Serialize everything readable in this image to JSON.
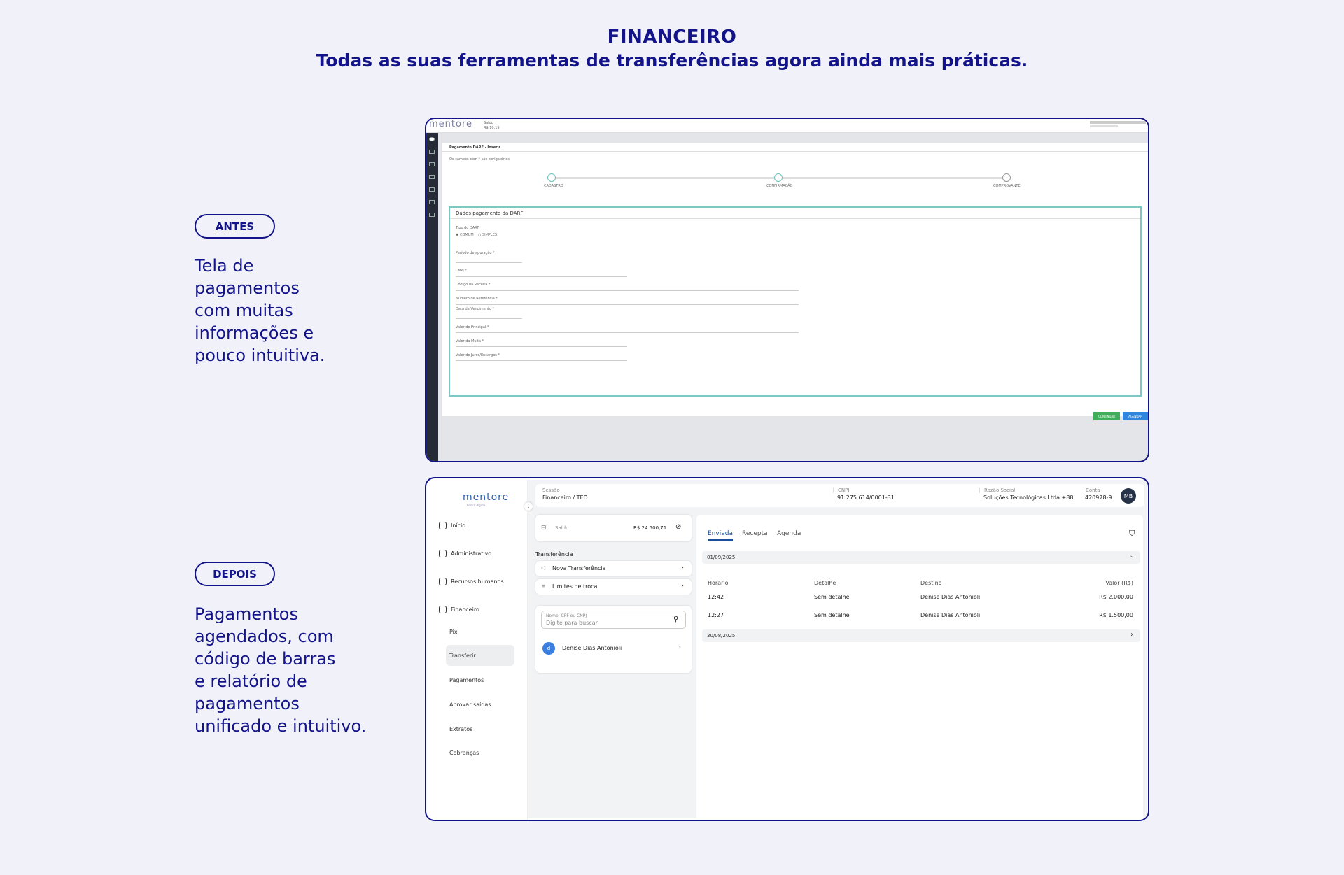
{
  "hero": {
    "title": "FINANCEIRO",
    "subtitle": "Todas as suas ferramentas de transferências agora ainda mais práticas."
  },
  "before": {
    "label": "ANTES",
    "lines": [
      "Tela de",
      "pagamentos",
      "com muitas",
      "informações e",
      "pouco intuitiva."
    ],
    "screen": {
      "logo": "mentore",
      "saldo_label": "Saldo",
      "saldo_value": "R$ 10,19",
      "window_title": "Pagamento DARF - Inserir",
      "required_note": "Os campos com * são obrigatórios",
      "steps": [
        "CADASTRO",
        "CONFIRMAÇÃO",
        "COMPROVANTE"
      ],
      "card_title": "Dados pagamento da DARF",
      "darf_type_label": "Tipo do DARF",
      "darf_options": [
        "COMUM",
        "SIMPLES"
      ],
      "fields": [
        "Período de apuração *",
        "CNPJ *",
        "Código da Receita *",
        "Número de Referência *",
        "Data de Vencimento *",
        "Valor do Principal *",
        "Valor da Multa *",
        "Valor do Juros/Encargos *"
      ],
      "btn_continue": "CONTINUAR",
      "btn_schedule": "AGENDAR",
      "colors": {
        "continue": "#3fae5a",
        "schedule": "#2f86dc"
      }
    }
  },
  "after": {
    "label": "DEPOIS",
    "lines": [
      "Pagamentos",
      "agendados, com",
      "código de barras",
      "e relatório de",
      "pagamentos",
      "unificado e intuitivo."
    ],
    "screen": {
      "logo": "mentore",
      "logo_sub": "banco digital",
      "nav": [
        "Início",
        "Administrativo",
        "Recursos humanos",
        "Financeiro"
      ],
      "subnav": [
        "Pix",
        "Transferir",
        "Pagamentos",
        "Aprovar saídas",
        "Extratos",
        "Cobranças"
      ],
      "header": {
        "session_label": "Sessão",
        "session_value": "Financeiro / TED",
        "cnpj_label": "CNPJ",
        "cnpj_value": "91.275.614/0001-31",
        "razao_label": "Razão Social",
        "razao_value": "Soluções Tecnológicas Ltda +88",
        "conta_label": "Conta",
        "conta_value": "420978-9",
        "avatar": "MB"
      },
      "saldo_label": "Saldo",
      "saldo_value": "R$ 24.500,71",
      "transfer_heading": "Transferência",
      "actions": [
        "Nova Transferência",
        "Limites de troca"
      ],
      "search_label": "Nome, CPF ou CNPJ",
      "search_placeholder": "Digite para buscar",
      "contact": "Denise Dias Antonioli",
      "contact_initial": "d",
      "tabs": [
        "Enviada",
        "Recepta",
        "Agenda"
      ],
      "group1_date": "01/09/2025",
      "group2_date": "30/08/2025",
      "columns": [
        "Horário",
        "Detalhe",
        "Destino",
        "Valor (R$)"
      ],
      "rows": [
        {
          "time": "12:42",
          "detail": "Sem detalhe",
          "dest": "Denise Dias Antonioli",
          "value": "R$ 2.000,00"
        },
        {
          "time": "12:27",
          "detail": "Sem detalhe",
          "dest": "Denise Dias Antonioli",
          "value": "R$ 1.500,00"
        }
      ]
    }
  }
}
